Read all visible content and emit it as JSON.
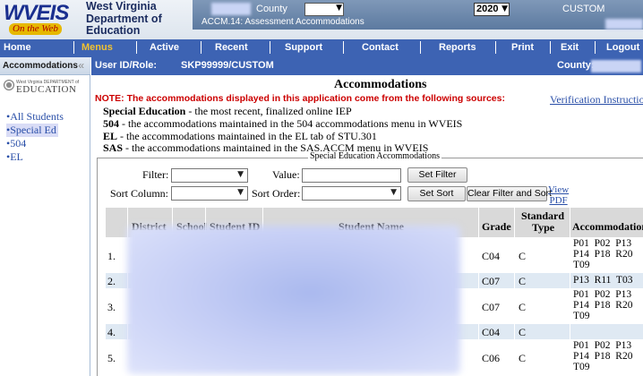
{
  "header": {
    "logo_text": "WVEIS",
    "logo_tagline": "On the Web",
    "department": "West Virginia Department of Education",
    "county_label": "County",
    "module_title": "ACCM.14: Assessment Accommodations",
    "year": "2020",
    "custom_label": "CUSTOM"
  },
  "nav": {
    "items": [
      "Home",
      "Menus",
      "Active",
      "Recent",
      "Support",
      "Contact",
      "Reports",
      "Print",
      "Exit",
      "Logout"
    ]
  },
  "sidebar": {
    "title": "Accommodations",
    "collapse": "«",
    "logo_small": "West Virginia DEPARTMENT of",
    "logo_big": "EDUCATION",
    "links": [
      "•All Students",
      "•Special Ed",
      "•504",
      "•EL"
    ]
  },
  "userbar": {
    "label": "User ID/Role:",
    "value": "SKP99999/CUSTOM",
    "county_label": "County:"
  },
  "main": {
    "title": "Accommodations",
    "verification_link": "Verification Instructions",
    "note": "NOTE: The accommodations displayed in this application come from the following sources:",
    "sources": [
      {
        "name": "Special Education",
        "desc": " - the most recent, finalized online IEP"
      },
      {
        "name": "504",
        "desc": " - the accommodations maintained in the 504 accommodations menu in WVEIS"
      },
      {
        "name": "EL",
        "desc": " - the accommodations maintained in the EL tab of STU.301"
      },
      {
        "name": "SAS",
        "desc": " - the accommodations maintained in the SAS.ACCM menu in WVEIS"
      }
    ],
    "section_legend": "Special Education Accommodations",
    "controls": {
      "filter_label": "Filter:",
      "value_label": "Value:",
      "set_filter": "Set Filter",
      "sort_column_label": "Sort Column:",
      "sort_order_label": "Sort Order:",
      "set_sort": "Set Sort",
      "clear": "Clear Filter and Sort",
      "view_pdf_1": "View",
      "view_pdf_2": "PDF"
    },
    "table": {
      "headers": {
        "district": "District",
        "school": "School",
        "student_id": "Student ID",
        "student_name": "Student Name",
        "grade": "Grade",
        "standard_type_1": "Standard",
        "standard_type_2": "Type",
        "accommodations": "Accommodations"
      },
      "rows": [
        {
          "num": "1.",
          "grade": "C04",
          "type": "C",
          "acc": "P01  P02  P13\nP14  P18  R20\nT09"
        },
        {
          "num": "2.",
          "grade": "C07",
          "type": "C",
          "acc": "P13  R11  T03"
        },
        {
          "num": "3.",
          "grade": "C07",
          "type": "C",
          "acc": "P01  P02  P13\nP14  P18  R20\nT09"
        },
        {
          "num": "4.",
          "grade": "C04",
          "type": "C",
          "acc": ""
        },
        {
          "num": "5.",
          "grade": "C06",
          "type": "C",
          "acc": "P01  P02  P13\nP14  P18  R20\nT09"
        }
      ]
    }
  },
  "colors": {
    "nav_bg": "#3d63b3",
    "menus_highlight": "#f2c230",
    "note_red": "#cc0000",
    "link_blue": "#2a4fa8",
    "row_shade": "#dfe9f3",
    "header_gray": "#d9d9d9"
  }
}
